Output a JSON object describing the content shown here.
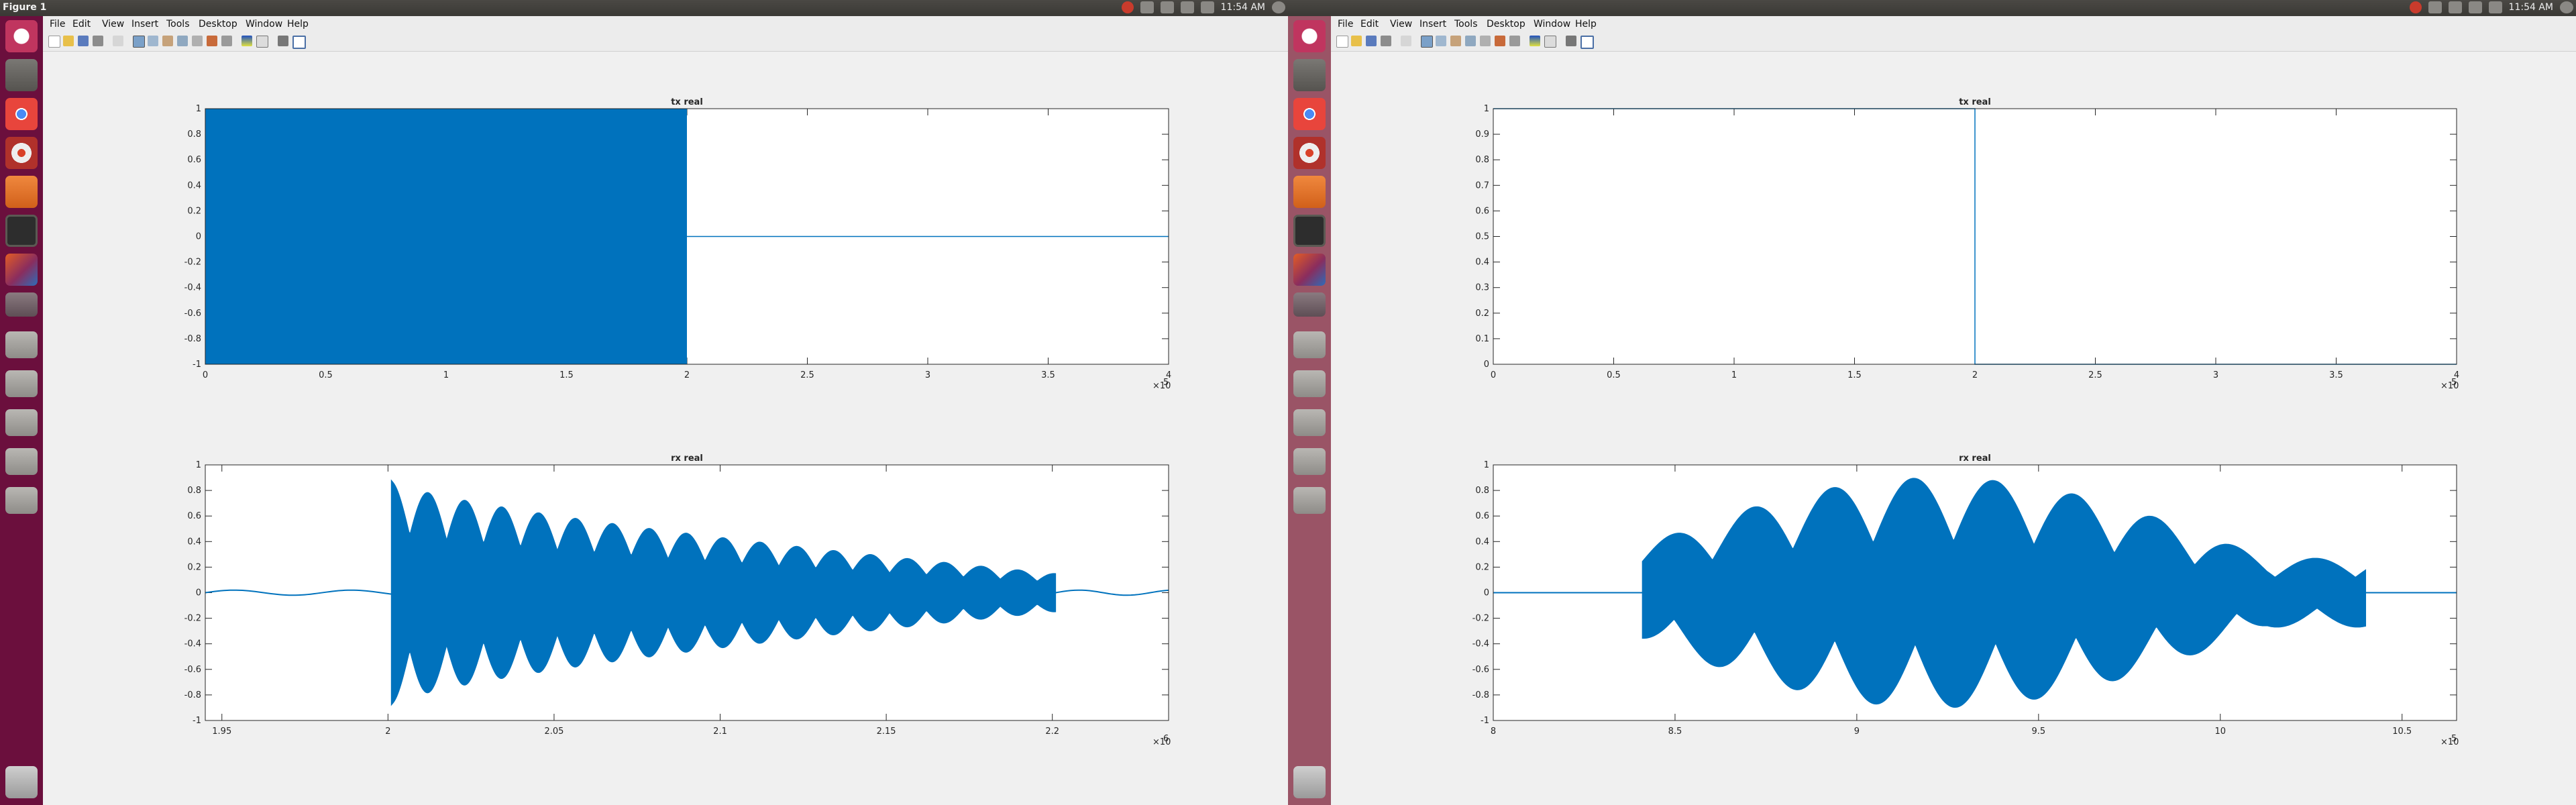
{
  "window_left": {
    "title": "Figure 1",
    "clock": "11:54 AM"
  },
  "window_right": {
    "clock": "11:54 AM"
  },
  "launcher_icons": [
    "dash-home-icon",
    "files-icon",
    "chrome-icon",
    "settings-icon",
    "orange-app-icon",
    "terminal-icon",
    "matlab-icon",
    "usb-drive-icon",
    "drive-icon",
    "drive-icon",
    "drive-icon",
    "drive-icon",
    "drive-icon",
    "trash-icon"
  ],
  "menu": [
    "File",
    "Edit",
    "View",
    "Insert",
    "Tools",
    "Desktop",
    "Window",
    "Help"
  ],
  "colors": {
    "plot_blue": "#0072bd",
    "launcher_left": "#6b0f3d",
    "launcher_right": "#9a5466"
  },
  "chart_data": [
    {
      "panel": "left-top",
      "type": "area",
      "title": "tx real",
      "xlim": [
        0,
        400000
      ],
      "ylim": [
        -1,
        1
      ],
      "xticks": [
        "0",
        "0.5",
        "1",
        "1.5",
        "2",
        "2.5",
        "3",
        "3.5",
        "4"
      ],
      "yticks": [
        "-1",
        "-0.8",
        "-0.6",
        "-0.4",
        "-0.2",
        "0",
        "0.2",
        "0.4",
        "0.6",
        "0.8",
        "1"
      ],
      "exponent": "×10",
      "exponent_power": "5",
      "series": [
        {
          "x_start": 0,
          "x_end": 200000,
          "envelope": [
            -1,
            1
          ],
          "tail_value": 0
        }
      ]
    },
    {
      "panel": "left-bottom",
      "type": "area",
      "title": "rx real",
      "xlim": [
        1945000,
        2235000
      ],
      "ylim": [
        -1,
        1
      ],
      "xticks": [
        "1.95",
        "2",
        "2.05",
        "2.1",
        "2.15",
        "2.2"
      ],
      "yticks": [
        "-1",
        "-0.8",
        "-0.6",
        "-0.4",
        "-0.2",
        "0",
        "0.2",
        "0.4",
        "0.6",
        "0.8",
        "1"
      ],
      "exponent": "×10",
      "exponent_power": "6",
      "series": [
        {
          "x_start": 2001000,
          "x_end": 2201000,
          "burst_start_amplitude": 0.88,
          "burst_end_amplitude": 0.15,
          "oscillations": 18
        }
      ]
    },
    {
      "panel": "right-top",
      "type": "line",
      "title": "tx real",
      "xlim": [
        0,
        400000
      ],
      "ylim": [
        0,
        1
      ],
      "xticks": [
        "0",
        "0.5",
        "1",
        "1.5",
        "2",
        "2.5",
        "3",
        "3.5",
        "4"
      ],
      "yticks": [
        "0",
        "0.1",
        "0.2",
        "0.3",
        "0.4",
        "0.5",
        "0.6",
        "0.7",
        "0.8",
        "0.9",
        "1"
      ],
      "exponent": "×10",
      "exponent_power": "5",
      "series": [
        {
          "pulse_x": 200000,
          "before_value": 1,
          "after_value": 0
        }
      ]
    },
    {
      "panel": "right-bottom",
      "type": "area",
      "title": "rx real",
      "xlim": [
        800000,
        1065000
      ],
      "ylim": [
        -1,
        1
      ],
      "xticks": [
        "8",
        "8.5",
        "9",
        "9.5",
        "10",
        "10.5"
      ],
      "yticks": [
        "-1",
        "-0.8",
        "-0.6",
        "-0.4",
        "-0.2",
        "0",
        "0.2",
        "0.4",
        "0.6",
        "0.8",
        "1"
      ],
      "exponent": "×10",
      "exponent_power": "5",
      "series": [
        {
          "x_start": 841000,
          "x_end": 1040000,
          "peak_amplitude": 0.9,
          "oscillations": 9
        }
      ]
    }
  ]
}
